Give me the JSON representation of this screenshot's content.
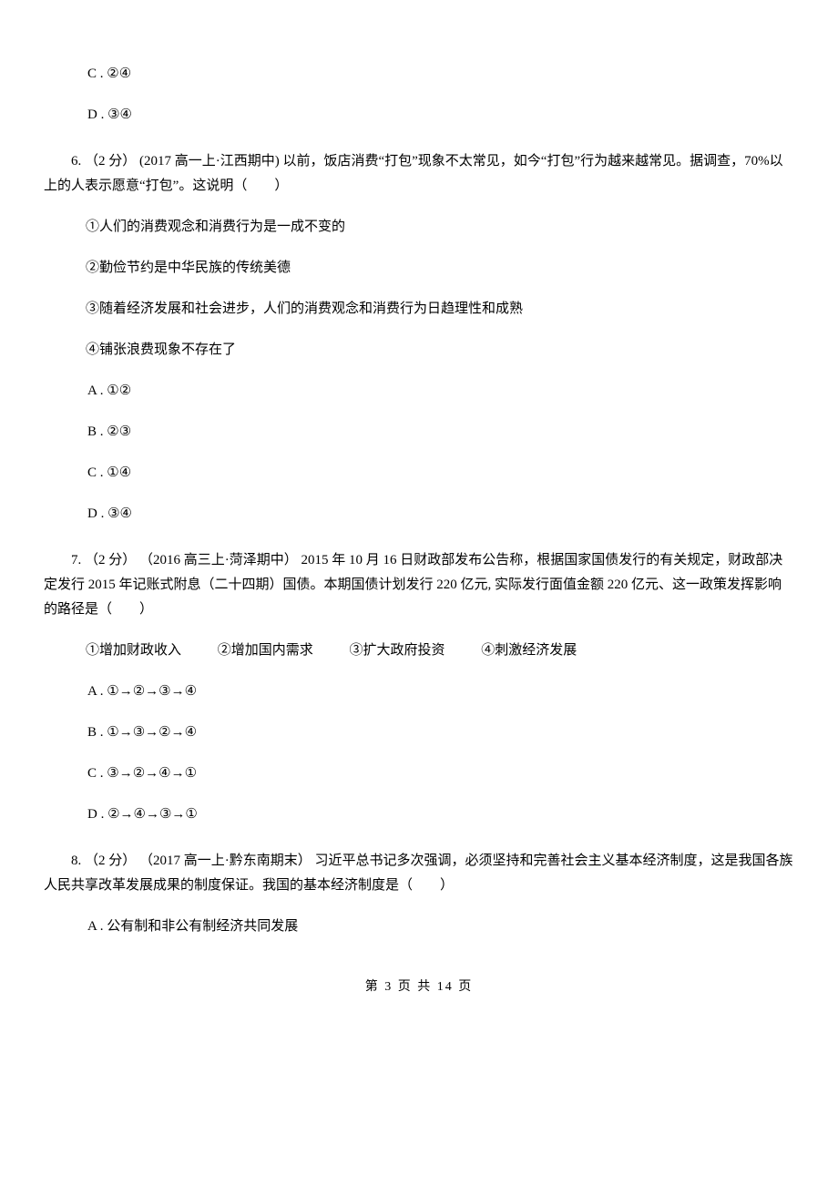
{
  "top_options": {
    "c": "C . ②④",
    "d": "D . ③④"
  },
  "q6": {
    "stem": "6. （2 分） (2017 高一上·江西期中) 以前，饭店消费“打包”现象不太常见，如今“打包”行为越来越常见。据调查，70%以上的人表示愿意“打包”。这说明（　　）",
    "s1": "①人们的消费观念和消费行为是一成不变的",
    "s2": "②勤俭节约是中华民族的传统美德",
    "s3": "③随着经济发展和社会进步，人们的消费观念和消费行为日趋理性和成熟",
    "s4": "④铺张浪费现象不存在了",
    "a": "A . ①②",
    "b": "B . ②③",
    "c": "C . ①④",
    "d": "D . ③④"
  },
  "q7": {
    "stem": "7. （2 分） （2016 高三上·菏泽期中） 2015 年 10 月 16 日财政部发布公告称，根据国家国债发行的有关规定，财政部决定发行 2015 年记账式附息（二十四期）国债。本期国债计划发行 220 亿元, 实际发行面值金额 220 亿元、这一政策发挥影响的路径是（　　）",
    "i1": "①增加财政收入",
    "i2": "②增加国内需求",
    "i3": "③扩大政府投资",
    "i4": "④刺激经济发展",
    "a": "A . ①→②→③→④",
    "b": "B . ①→③→②→④",
    "c": "C . ③→②→④→①",
    "d": "D . ②→④→③→①"
  },
  "q8": {
    "stem": "8. （2 分） （2017 高一上·黔东南期末） 习近平总书记多次强调，必须坚持和完善社会主义基本经济制度，这是我国各族人民共享改革发展成果的制度保证。我国的基本经济制度是（　　）",
    "a": "A . 公有制和非公有制经济共同发展"
  },
  "footer": "第 3 页 共 14 页"
}
